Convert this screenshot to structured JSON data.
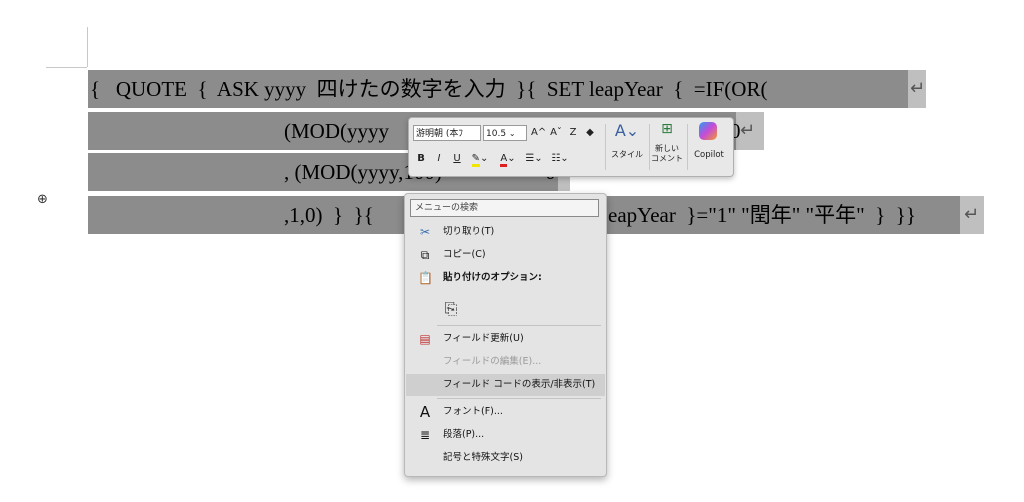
{
  "document": {
    "line1": "{   QUOTE  {  ASK yyyy  四けたの数字を入力  }{  SET leapYear  {  =IF(OR(",
    "line2_a": "(MOD(yyyy",
    "line2_b": "0",
    "line3": ", (MOD(yyyy,100)",
    "line3_b": "> 0",
    "line4_a": ",1,0)  }  }{  ",
    "line4_b": "eapYear  }=\"1\" \"閏年\" \"平年\"  }  }}",
    "pilcrow": "↵",
    "anchor": "⊕"
  },
  "mini_toolbar": {
    "font_name": "游明朝 (本ﾌ",
    "font_size": "10.5",
    "grow_font": "A^",
    "shrink_font": "Aˇ",
    "clear_format": "Z",
    "format_painter": "🖌",
    "bold": "B",
    "italic": "I",
    "underline": "U",
    "highlight": "🖍",
    "font_color": "A",
    "bullets": "☰",
    "numbering": "☰",
    "styles_label": "スタイル",
    "new_comment_label_1": "新しい",
    "new_comment_label_2": "コメント",
    "copilot_label": "Copilot"
  },
  "context_menu": {
    "search_placeholder": "メニューの検索",
    "items": [
      {
        "label": "切り取り(T)",
        "icon": "scissors-icon"
      },
      {
        "label": "コピー(C)",
        "icon": "copy-icon"
      },
      {
        "label": "貼り付けのオプション:",
        "icon": "paste-icon"
      },
      {
        "label": "フィールド更新(U)",
        "icon": "field-update-icon"
      },
      {
        "label": "フィールドの編集(E)...",
        "icon": ""
      },
      {
        "label": "フィールド コードの表示/非表示(T)",
        "icon": ""
      },
      {
        "label": "フォント(F)...",
        "icon": "font-icon"
      },
      {
        "label": "段落(P)...",
        "icon": "paragraph-icon"
      },
      {
        "label": "記号と特殊文字(S)",
        "icon": ""
      }
    ]
  }
}
